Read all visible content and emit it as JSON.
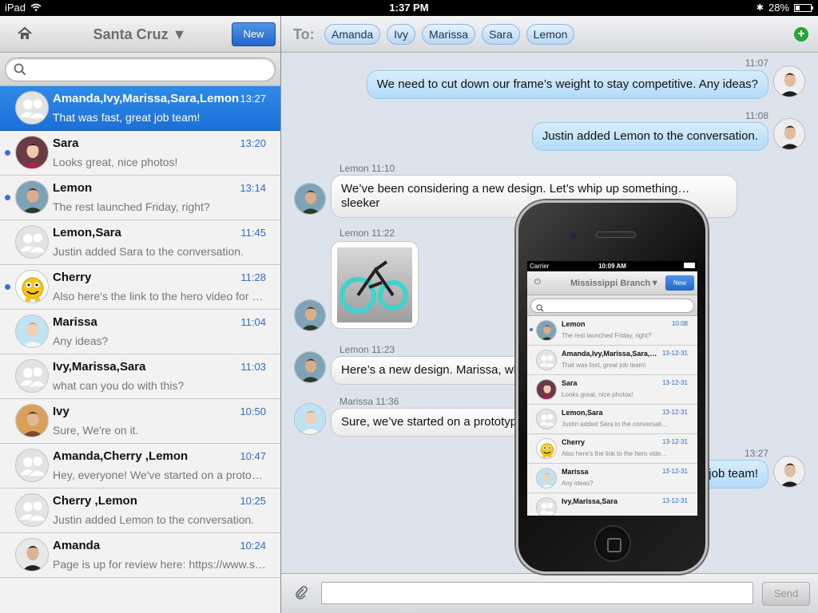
{
  "status_bar": {
    "device": "iPad",
    "time": "1:37 PM",
    "battery": "28%",
    "battery_level": 0.28
  },
  "sidebar": {
    "title": "Santa Cruz ▼",
    "new_button": "New",
    "search_placeholder": "",
    "conversations": [
      {
        "name": "Amanda,Ivy,Marissa,Sara,Lemon",
        "time": "13:27",
        "preview": "That was fast, great job team!",
        "selected": true,
        "unread": false,
        "avatar": "group"
      },
      {
        "name": "Sara",
        "time": "13:20",
        "preview": "Looks great, nice photos!",
        "selected": false,
        "unread": true,
        "avatar": "sara"
      },
      {
        "name": "Lemon",
        "time": "13:14",
        "preview": "The rest launched Friday, right?",
        "selected": false,
        "unread": true,
        "avatar": "lemon"
      },
      {
        "name": "Lemon,Sara",
        "time": "11:45",
        "preview": "Justin added Sara to the conversation.",
        "selected": false,
        "unread": false,
        "avatar": "group"
      },
      {
        "name": "Cherry",
        "time": "11:28",
        "preview": "Also here's the link to the hero video for …",
        "selected": false,
        "unread": true,
        "avatar": "cherry"
      },
      {
        "name": "Marissa",
        "time": "11:04",
        "preview": "Any ideas?",
        "selected": false,
        "unread": false,
        "avatar": "marissa"
      },
      {
        "name": "Ivy,Marissa,Sara",
        "time": "11:03",
        "preview": "what can you do with this?",
        "selected": false,
        "unread": false,
        "avatar": "group"
      },
      {
        "name": "Ivy",
        "time": "10:50",
        "preview": "Sure, We're on it.",
        "selected": false,
        "unread": false,
        "avatar": "ivy"
      },
      {
        "name": "Amanda,Cherry ,Lemon",
        "time": "10:47",
        "preview": "Hey, everyone! We've started on a proto…",
        "selected": false,
        "unread": false,
        "avatar": "group"
      },
      {
        "name": "Cherry ,Lemon",
        "time": "10:25",
        "preview": "Justin added Lemon to the conversation.",
        "selected": false,
        "unread": false,
        "avatar": "group"
      },
      {
        "name": "Amanda",
        "time": "10:24",
        "preview": "Page is up for review here: https://www.s…",
        "selected": false,
        "unread": false,
        "avatar": "amanda"
      }
    ]
  },
  "chat": {
    "to_label": "To:",
    "recipients": [
      "Amanda",
      "Ivy",
      "Marissa",
      "Sara",
      "Lemon"
    ],
    "messages": [
      {
        "timestamp": "11:07",
        "text": "We need to cut down our frame’s weight to stay competitive. Any ideas?",
        "direction": "out"
      },
      {
        "timestamp": "11:08",
        "text": "Justin added Lemon to the conversation.",
        "direction": "out"
      },
      {
        "timestamp": "Lemon 11:10",
        "text": "We’ve been considering a new design. Let’s whip up something… sleeker",
        "direction": "in"
      },
      {
        "timestamp": "Lemon 11:22",
        "text": "",
        "direction": "in",
        "kind": "photo"
      },
      {
        "timestamp": "Lemon 11:23",
        "text": "Here’s a new design. Marissa, wh",
        "direction": "in"
      },
      {
        "timestamp": "Marissa 11:36",
        "text": "Sure, we’ve started on a prototyp",
        "direction": "in"
      },
      {
        "timestamp": "13:27",
        "text": "job team!",
        "direction": "out"
      }
    ],
    "send_label": "Send"
  },
  "phone": {
    "carrier": "Carrier",
    "time": "10:09 AM",
    "title": "Mississippi Branch▼",
    "new_button": "New",
    "conversations": [
      {
        "name": "Lemon",
        "time": "10:08",
        "preview": "The rest launched Friday, right?",
        "unread": true,
        "avatar": "lemon"
      },
      {
        "name": "Amanda,Ivy,Marissa,Sara,…",
        "time": "13-12-31",
        "preview": "That was fast, great job team!",
        "unread": false,
        "avatar": "group"
      },
      {
        "name": "Sara",
        "time": "13-12-31",
        "preview": "Looks great, nice photos!",
        "unread": false,
        "avatar": "sara"
      },
      {
        "name": "Lemon,Sara",
        "time": "13-12-31",
        "preview": "Justin added Sara to the conversati…",
        "unread": false,
        "avatar": "group"
      },
      {
        "name": "Cherry",
        "time": "13-12-31",
        "preview": "Also here's the link to the hero vide…",
        "unread": false,
        "avatar": "cherry"
      },
      {
        "name": "Marissa",
        "time": "13-12-31",
        "preview": "Any ideas?",
        "unread": false,
        "avatar": "marissa"
      },
      {
        "name": "Ivy,Marissa,Sara",
        "time": "13-12-31",
        "preview": "",
        "unread": false,
        "avatar": "group"
      }
    ]
  }
}
